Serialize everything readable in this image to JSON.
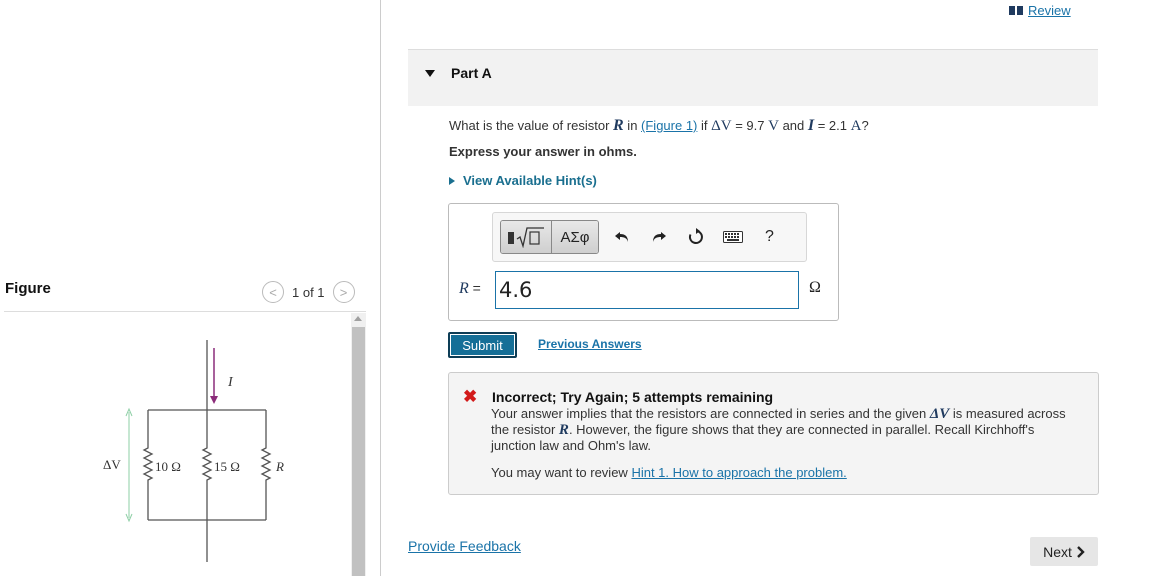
{
  "figure_panel": {
    "title": "Figure",
    "pager": {
      "text": "1 of 1",
      "prev": "<",
      "next": ">"
    },
    "circuit": {
      "current_label": "I",
      "voltage_label": "ΔV",
      "resistors": [
        "10 Ω",
        "15 Ω",
        "R"
      ],
      "colors": {
        "arrow": "#8b2c7a",
        "wire": "#555555",
        "voltage_arrow": "#8ecfa6"
      }
    }
  },
  "header": {
    "review": "Review"
  },
  "part": {
    "label": "Part A",
    "question": {
      "prefix": "What is the value of resistor ",
      "var_r": "R",
      "mid": " in ",
      "figure_link": "(Figure 1)",
      "if": " if ",
      "dv": "ΔV",
      "dv_eq": " = 9.7 ",
      "unit_v": "V",
      "and": " and ",
      "var_i": "I",
      "i_eq": " = 2.1 ",
      "unit_a": "A",
      "end": "?"
    },
    "instruction": "Express your answer in ohms.",
    "hints_link": "View Available Hint(s)"
  },
  "answer": {
    "toolbar": {
      "template_icon": "square-root-template-icon",
      "symbols": "ΑΣφ",
      "undo_icon": "undo-icon",
      "redo_icon": "redo-icon",
      "reset_icon": "reset-icon",
      "keyboard_icon": "keyboard-icon",
      "help": "?"
    },
    "variable": "R",
    "equals": "=",
    "value": "4.6",
    "unit": "Ω"
  },
  "actions": {
    "submit": "Submit",
    "previous_answers": "Previous Answers"
  },
  "feedback": {
    "title": "Incorrect; Try Again; 5 attempts remaining",
    "line1a": "Your answer implies that the resistors are connected in series and the given ",
    "line1_dv": "ΔV",
    "line1b": " is measured across the resistor ",
    "line1_r": "R",
    "line1c": ". However, the figure shows that they are connected in parallel. Recall Kirchhoff's junction law and Ohm's law.",
    "review_prefix": "You may want to review ",
    "review_link": "Hint 1. How to approach the problem."
  },
  "footer": {
    "provide_feedback": "Provide Feedback",
    "next": "Next"
  },
  "colors": {
    "accent": "#1a73a8",
    "submit_bg": "#156f97",
    "error": "#d21a1a"
  }
}
